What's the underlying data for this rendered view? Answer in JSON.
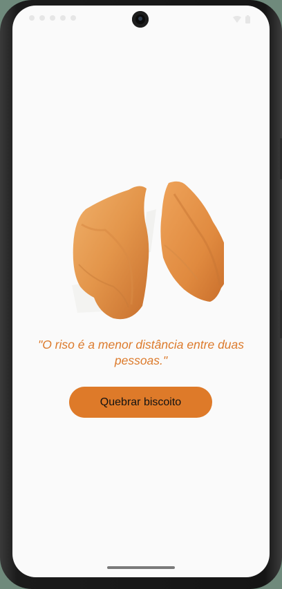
{
  "app": {
    "quote": "\"O riso é a menor distância entre duas pessoas.\"",
    "button_label": "Quebrar biscoito"
  },
  "theme": {
    "accent": "#de7a29",
    "quote_color": "#dc7a2b",
    "background": "#fafafa"
  },
  "icons": {
    "status_left": [
      "notification-icon",
      "notification-icon",
      "notification-icon",
      "notification-icon",
      "notification-icon"
    ],
    "status_right": [
      "wifi-icon",
      "battery-icon"
    ],
    "image": "fortune-cookie-image"
  }
}
